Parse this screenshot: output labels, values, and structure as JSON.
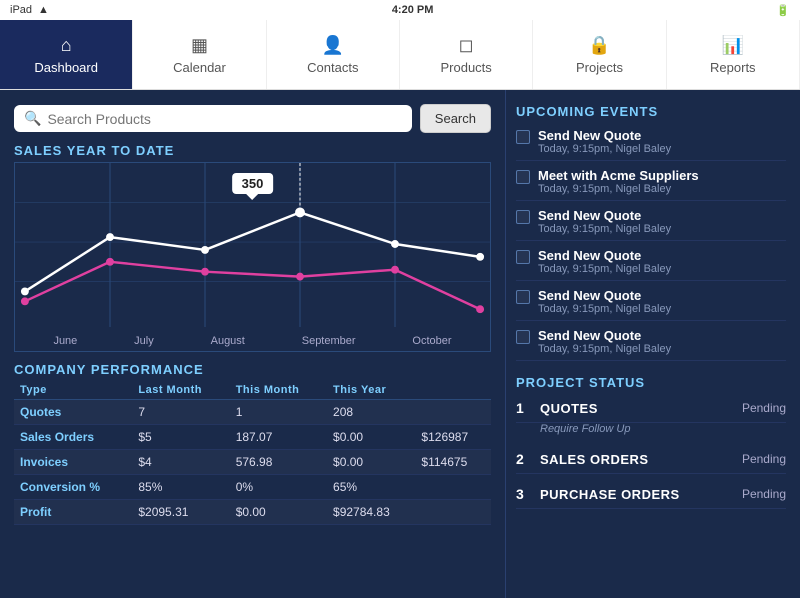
{
  "status_bar": {
    "time": "4:20 PM",
    "carrier": "iPad",
    "wifi": "wifi",
    "battery": "battery"
  },
  "nav": {
    "items": [
      {
        "id": "dashboard",
        "label": "Dashboard",
        "icon": "⌂",
        "active": true
      },
      {
        "id": "calendar",
        "label": "Calendar",
        "icon": "▦",
        "active": false
      },
      {
        "id": "contacts",
        "label": "Contacts",
        "icon": "👤",
        "active": false
      },
      {
        "id": "products",
        "label": "Products",
        "icon": "◻",
        "active": false
      },
      {
        "id": "projects",
        "label": "Projects",
        "icon": "🔒",
        "active": false
      },
      {
        "id": "reports",
        "label": "Reports",
        "icon": "📊",
        "active": false
      }
    ]
  },
  "search": {
    "placeholder": "Search Products",
    "button_label": "Search"
  },
  "sales_chart": {
    "title": "SALES YEAR TO DATE",
    "tooltip_value": "350",
    "x_labels": [
      "June",
      "July",
      "August",
      "September",
      "October"
    ]
  },
  "performance": {
    "title": "COMPANY PERFORMANCE",
    "headers": [
      "Type",
      "Last Month",
      "This Month",
      "This Year",
      ""
    ],
    "rows": [
      {
        "type": "Quotes",
        "last_month": "7",
        "this_month": "1",
        "this_year": "208",
        "extra": ""
      },
      {
        "type": "Sales Orders",
        "last_month": "$5",
        "this_month": "187.07",
        "this_year": "$0.00",
        "extra": "$126987"
      },
      {
        "type": "Invoices",
        "last_month": "$4",
        "this_month": "576.98",
        "this_year": "$0.00",
        "extra": "$114675"
      },
      {
        "type": "Conversion %",
        "last_month": "85%",
        "this_month": "0%",
        "this_year": "65%",
        "extra": ""
      },
      {
        "type": "Profit",
        "last_month": "$2095.31",
        "this_month": "$0.00",
        "this_year": "$92784.83",
        "extra": ""
      }
    ]
  },
  "upcoming_events": {
    "title": "UPCOMING EVENTS",
    "events": [
      {
        "title": "Send New Quote",
        "sub": "Today, 9:15pm, Nigel Baley"
      },
      {
        "title": "Meet with Acme Suppliers",
        "sub": "Today, 9:15pm, Nigel Baley"
      },
      {
        "title": "Send New Quote",
        "sub": "Today, 9:15pm, Nigel Baley"
      },
      {
        "title": "Send New Quote",
        "sub": "Today, 9:15pm, Nigel Baley"
      },
      {
        "title": "Send New Quote",
        "sub": "Today, 9:15pm, Nigel Baley"
      },
      {
        "title": "Send New Quote",
        "sub": "Today, 9:15pm, Nigel Baley"
      }
    ]
  },
  "project_status": {
    "title": "PROJECT STATUS",
    "items": [
      {
        "num": "1",
        "name": "QUOTES",
        "status": "Pending",
        "follow_up": "Require Follow Up"
      },
      {
        "num": "2",
        "name": "SALES ORDERS",
        "status": "Pending",
        "follow_up": ""
      },
      {
        "num": "3",
        "name": "PURCHASE ORDERS",
        "status": "Pending",
        "follow_up": ""
      }
    ]
  }
}
